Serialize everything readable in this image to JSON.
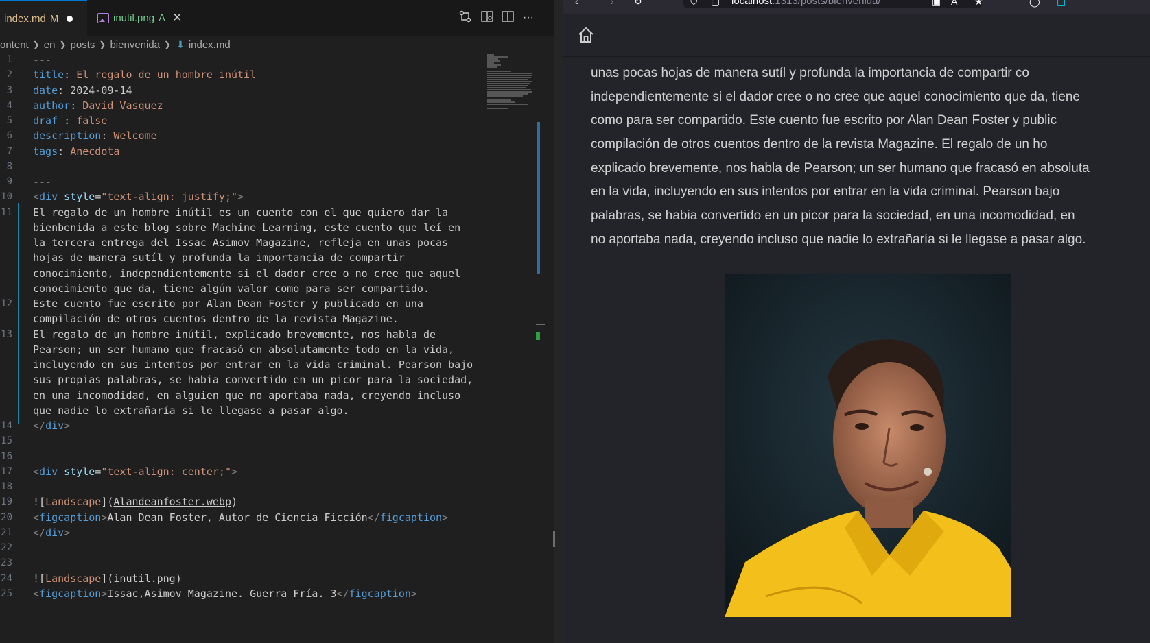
{
  "editor": {
    "tabs": [
      {
        "label": "index.md",
        "badge": "M"
      },
      {
        "label": "inutil.png",
        "badge": "A"
      }
    ],
    "breadcrumb": [
      "ontent",
      "en",
      "posts",
      "bienvenida",
      "index.md"
    ],
    "lines": [
      {
        "n": "1",
        "t": "---"
      },
      {
        "n": "2",
        "k": "title",
        "v": "El regalo de un hombre inútil"
      },
      {
        "n": "3",
        "k": "date",
        "v": "2024-09-14"
      },
      {
        "n": "4",
        "k": "author",
        "v": "David Vasquez"
      },
      {
        "n": "5",
        "k": "draf",
        "v": "false"
      },
      {
        "n": "6",
        "k": "description",
        "v": "Welcome"
      },
      {
        "n": "7",
        "k": "tags",
        "v": "Anecdota"
      },
      {
        "n": "8",
        "t": ""
      },
      {
        "n": "9",
        "t": "---"
      },
      {
        "n": "10",
        "t": "<div style=\"text-align: justify;\">"
      },
      {
        "n": "11",
        "t": "El regalo de un hombre inútil es un cuento con el que quiero dar la"
      },
      {
        "n": "",
        "t": "bienbenida a este blog sobre Machine Learning, este cuento que leí en"
      },
      {
        "n": "",
        "t": "la tercera entrega del Issac Asimov Magazine, refleja en unas pocas"
      },
      {
        "n": "",
        "t": "hojas de manera sutíl y profunda la importancia de compartir"
      },
      {
        "n": "",
        "t": "conocimiento, independientemente si el dador cree o no cree que aquel"
      },
      {
        "n": "",
        "t": "conocimiento que da, tiene algún valor como para ser compartido."
      },
      {
        "n": "12",
        "t": "Este cuento fue escrito por Alan Dean Foster y publicado en una"
      },
      {
        "n": "",
        "t": "compilación de otros cuentos dentro de la revista Magazine."
      },
      {
        "n": "13",
        "t": "El regalo de un hombre inútil, explicado brevemente, nos habla de"
      },
      {
        "n": "",
        "t": "Pearson; un ser humano que fracasó en absolutamente todo en la vida,"
      },
      {
        "n": "",
        "t": "incluyendo en sus intentos por entrar en la vida criminal. Pearson bajo"
      },
      {
        "n": "",
        "t": "sus propias palabras, se habia convertido en un picor para la sociedad,"
      },
      {
        "n": "",
        "t": "en una incomodidad, en alguien que no aportaba nada, creyendo incluso"
      },
      {
        "n": "",
        "t": "que nadie lo extrañaría si le llegase a pasar algo."
      },
      {
        "n": "14",
        "t": "</div>"
      },
      {
        "n": "15",
        "t": ""
      },
      {
        "n": "16",
        "t": ""
      },
      {
        "n": "17",
        "t": "<div style=\"text-align: center;\">"
      },
      {
        "n": "18",
        "t": ""
      },
      {
        "n": "19",
        "t": "![Landscape](Alandeanfoster.webp)"
      },
      {
        "n": "20",
        "t": "<figcaption>Alan Dean Foster, Autor de Ciencia Ficción</figcaption>"
      },
      {
        "n": "21",
        "t": "</div>"
      },
      {
        "n": "22",
        "t": ""
      },
      {
        "n": "23",
        "t": ""
      },
      {
        "n": "24",
        "t": "![Landscape](inutil.png)"
      },
      {
        "n": "25",
        "t": "<figcaption>Issac,Asimov Magazine. Guerra Fría. 3</figcaption>"
      }
    ]
  },
  "browser": {
    "url_host": "localhost",
    "url_path": ":1313/posts/bienvenida/",
    "article_lines": [
      "unas pocas hojas de manera sutíl y profunda la importancia de compartir co",
      "independientemente si el dador cree o no cree que aquel conocimiento que da, tiene",
      "como para ser compartido. Este cuento fue escrito por Alan Dean Foster y public",
      "compilación de otros cuentos dentro de la revista Magazine. El regalo de un ho",
      "explicado brevemente, nos habla de Pearson; un ser humano que fracasó en absoluta",
      "en la vida, incluyendo en sus intentos por entrar en la vida criminal. Pearson bajo",
      "palabras, se habia convertido en un picor para la sociedad, en una incomodidad, en",
      "no aportaba nada, creyendo incluso que nadie lo extrañaría si le llegase a pasar algo."
    ]
  },
  "colors": {
    "editor_bg": "#1f1f1f",
    "modified": "#e2c08d",
    "added": "#73c991",
    "accent": "#0078d4",
    "browser_bg": "#23242a"
  },
  "icons": [
    "compare-changes-icon",
    "open-preview-icon",
    "split-editor-icon",
    "more-actions-icon",
    "home-icon",
    "markdown-file-icon",
    "image-file-icon"
  ]
}
